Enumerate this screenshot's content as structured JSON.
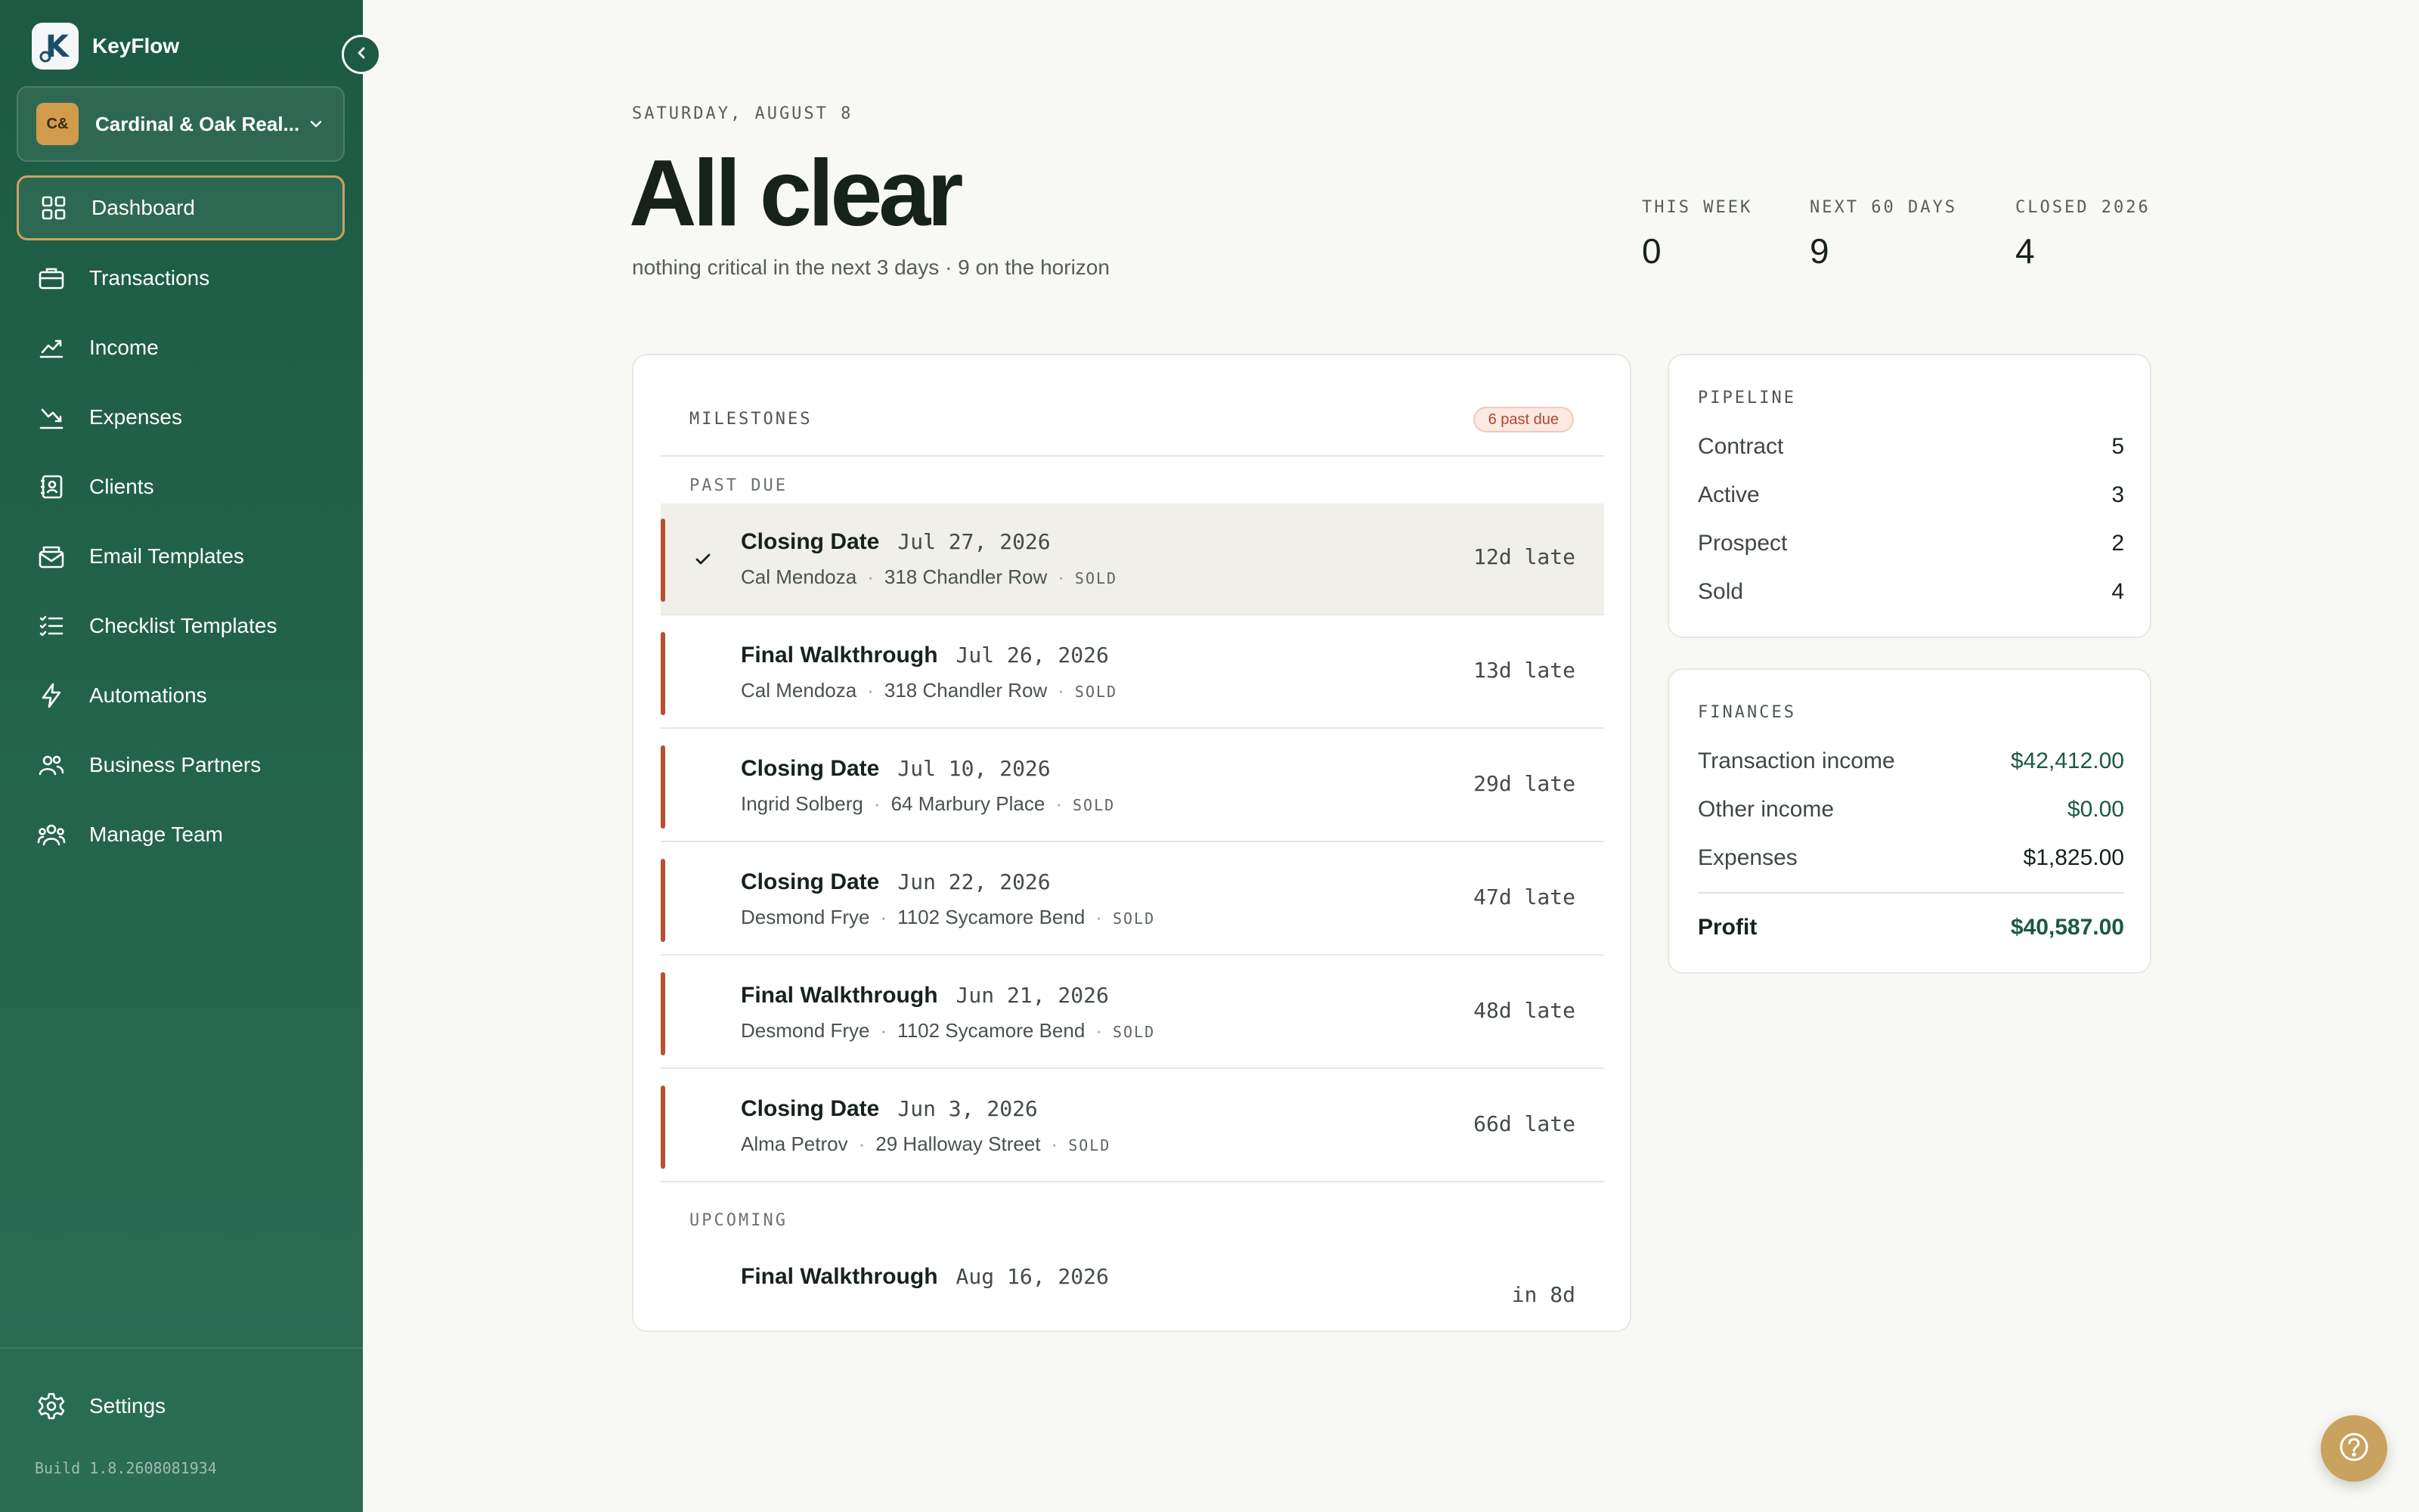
{
  "app": {
    "name": "KeyFlow",
    "logo_letter": "K",
    "organization": "Cardinal & Oak Real...",
    "organization_initials": "C&",
    "build": "Build 1.8.2608081934"
  },
  "sidebar": {
    "items": [
      {
        "label": "Dashboard",
        "icon": "grid-icon",
        "active": true
      },
      {
        "label": "Transactions",
        "icon": "briefcase-icon"
      },
      {
        "label": "Income",
        "icon": "trending-up-icon"
      },
      {
        "label": "Expenses",
        "icon": "trending-down-icon"
      },
      {
        "label": "Clients",
        "icon": "contacts-icon"
      },
      {
        "label": "Email Templates",
        "icon": "mail-icon"
      },
      {
        "label": "Checklist Templates",
        "icon": "checklist-icon"
      },
      {
        "label": "Automations",
        "icon": "lightning-icon"
      },
      {
        "label": "Business Partners",
        "icon": "users-icon"
      },
      {
        "label": "Manage Team",
        "icon": "team-icon"
      }
    ],
    "settings_label": "Settings"
  },
  "header": {
    "date": "SATURDAY, AUGUST 8",
    "title": "All clear",
    "subtitle": "nothing critical in the next 3 days · 9 on the horizon",
    "stats": [
      {
        "label": "THIS WEEK",
        "value": "0"
      },
      {
        "label": "NEXT 60 DAYS",
        "value": "9"
      },
      {
        "label": "CLOSED 2026",
        "value": "4"
      }
    ]
  },
  "milestones": {
    "title": "MILESTONES",
    "badge": "6 past due",
    "past_due_label": "PAST DUE",
    "upcoming_label": "UPCOMING",
    "past_due": [
      {
        "title": "Closing Date",
        "date": "Jul 27, 2026",
        "client": "Cal Mendoza",
        "address": "318 Chandler Row",
        "status": "SOLD",
        "late": "12d late"
      },
      {
        "title": "Final Walkthrough",
        "date": "Jul 26, 2026",
        "client": "Cal Mendoza",
        "address": "318 Chandler Row",
        "status": "SOLD",
        "late": "13d late"
      },
      {
        "title": "Closing Date",
        "date": "Jul 10, 2026",
        "client": "Ingrid Solberg",
        "address": "64 Marbury Place",
        "status": "SOLD",
        "late": "29d late"
      },
      {
        "title": "Closing Date",
        "date": "Jun 22, 2026",
        "client": "Desmond Frye",
        "address": "1102 Sycamore Bend",
        "status": "SOLD",
        "late": "47d late"
      },
      {
        "title": "Final Walkthrough",
        "date": "Jun 21, 2026",
        "client": "Desmond Frye",
        "address": "1102 Sycamore Bend",
        "status": "SOLD",
        "late": "48d late"
      },
      {
        "title": "Closing Date",
        "date": "Jun 3, 2026",
        "client": "Alma Petrov",
        "address": "29 Halloway Street",
        "status": "SOLD",
        "late": "66d late"
      }
    ],
    "upcoming": [
      {
        "title": "Final Walkthrough",
        "date": "Aug 16, 2026",
        "due": "in 8d"
      }
    ]
  },
  "pipeline": {
    "title": "PIPELINE",
    "rows": [
      {
        "label": "Contract",
        "value": "5"
      },
      {
        "label": "Active",
        "value": "3"
      },
      {
        "label": "Prospect",
        "value": "2"
      },
      {
        "label": "Sold",
        "value": "4"
      }
    ]
  },
  "finances": {
    "title": "FINANCES",
    "rows": [
      {
        "label": "Transaction income",
        "value": "$42,412.00"
      },
      {
        "label": "Other income",
        "value": "$0.00"
      },
      {
        "label": "Expenses",
        "value": "$1,825.00"
      }
    ],
    "total_label": "Profit",
    "total_value": "$40,587.00"
  },
  "colors": {
    "sidebar": "#1c5a43",
    "accent_gold": "#c9a25f",
    "past_due": "#b8502f",
    "money_green": "#1b5a3f"
  }
}
